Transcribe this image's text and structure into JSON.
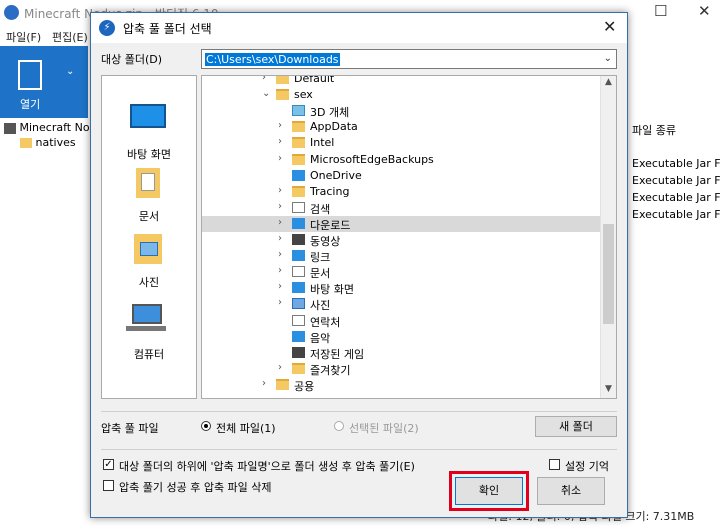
{
  "background_app": {
    "title": "Minecraft Nodus.zip - 반디집 6.10",
    "menu": [
      "파일(F)",
      "편집(E)"
    ],
    "open_label": "열기",
    "tree_items": [
      "Minecraft Nodus",
      "natives"
    ],
    "right_column_header": "파일 종류",
    "right_column_cells": [
      "Executable Jar File",
      "Executable Jar File",
      "Executable Jar File",
      "Executable Jar File"
    ],
    "status": "파일: 12, 폴더: 0, 압축 파일 크기: 7.31MB"
  },
  "dialog": {
    "title": "압축 풀 폴더 선택",
    "close_glyph": "✕",
    "target_label": "대상 폴더(D)",
    "target_path": "C:\\Users\\sex\\Downloads",
    "places": [
      {
        "label": "바탕 화면",
        "icon": "desktop-icon"
      },
      {
        "label": "문서",
        "icon": "documents-icon"
      },
      {
        "label": "사진",
        "icon": "pictures-icon"
      },
      {
        "label": "컴퓨터",
        "icon": "computer-icon"
      }
    ],
    "tree": [
      {
        "label": "Default",
        "icon": "folder-icon",
        "arrow": "›"
      },
      {
        "label": "sex",
        "icon": "folder-icon",
        "arrow": "⌄"
      },
      {
        "label": "3D 개체",
        "icon": "3d-objects-icon",
        "arrow": ""
      },
      {
        "label": "AppData",
        "icon": "folder-icon",
        "arrow": "›"
      },
      {
        "label": "Intel",
        "icon": "folder-icon",
        "arrow": "›"
      },
      {
        "label": "MicrosoftEdgeBackups",
        "icon": "folder-icon",
        "arrow": "›"
      },
      {
        "label": "OneDrive",
        "icon": "onedrive-icon",
        "arrow": ""
      },
      {
        "label": "Tracing",
        "icon": "folder-icon",
        "arrow": "›"
      },
      {
        "label": "검색",
        "icon": "search-icon",
        "arrow": "›"
      },
      {
        "label": "다운로드",
        "icon": "download-icon",
        "arrow": "›"
      },
      {
        "label": "동영상",
        "icon": "videos-icon",
        "arrow": "›"
      },
      {
        "label": "링크",
        "icon": "links-icon",
        "arrow": "›"
      },
      {
        "label": "문서",
        "icon": "documents-icon",
        "arrow": "›"
      },
      {
        "label": "바탕 화면",
        "icon": "desktop-icon",
        "arrow": "›"
      },
      {
        "label": "사진",
        "icon": "pictures-icon",
        "arrow": "›"
      },
      {
        "label": "연락처",
        "icon": "contacts-icon",
        "arrow": ""
      },
      {
        "label": "음악",
        "icon": "music-icon",
        "arrow": ""
      },
      {
        "label": "저장된 게임",
        "icon": "saved-games-icon",
        "arrow": ""
      },
      {
        "label": "즐겨찾기",
        "icon": "favorites-icon",
        "arrow": "›"
      },
      {
        "label": "공용",
        "icon": "folder-icon",
        "arrow": "›"
      }
    ],
    "selected_tree_index": 9,
    "files_label": "압축 풀 파일",
    "radio_all": "전체 파일(1)",
    "radio_selected": "선택된 파일(2)",
    "new_folder_button": "새 폴더",
    "check_subfolder": "대상 폴더의 하위에 '압축 파일명'으로 폴더 생성 후 압축 풀기(E)",
    "check_subfolder_checked": true,
    "check_delete": "압축 풀기 성공 후 압축 파일 삭제",
    "check_delete_checked": false,
    "check_remember": "설정 기억",
    "check_remember_checked": false,
    "ok_button": "확인",
    "cancel_button": "취소",
    "highlight_color": "#e0001b",
    "selection_color": "#0078d7"
  }
}
